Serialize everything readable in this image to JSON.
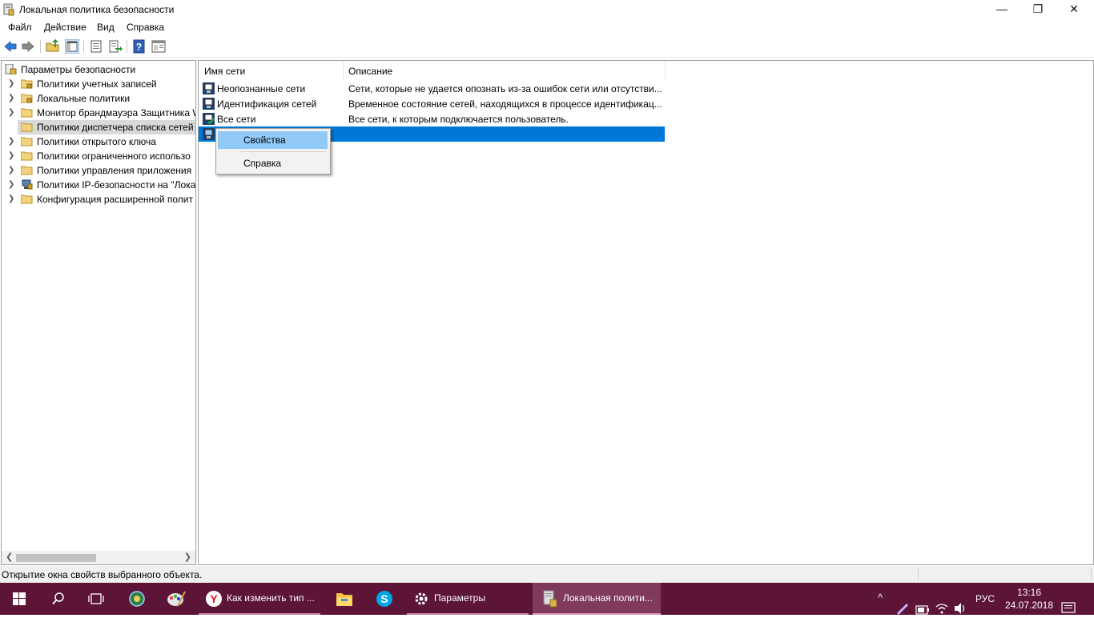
{
  "window": {
    "title": "Локальная политика безопасности",
    "controls": {
      "minimize": "—",
      "maximize": "❐",
      "close": "✕"
    }
  },
  "menu": [
    "Файл",
    "Действие",
    "Вид",
    "Справка"
  ],
  "toolbar": {
    "icons": [
      "back-icon",
      "forward-icon",
      "up-folder-icon",
      "show-hide-tree-icon",
      "properties-icon",
      "export-list-icon",
      "help-icon",
      "console-icon"
    ]
  },
  "tree": {
    "root": "Параметры безопасности",
    "items": [
      {
        "label": "Политики учетных записей",
        "icon": "folder-lock-icon",
        "selected": false
      },
      {
        "label": "Локальные политики",
        "icon": "folder-lock-icon",
        "selected": false
      },
      {
        "label": "Монитор брандмауэра Защитника W",
        "icon": "folder-icon",
        "selected": false
      },
      {
        "label": "Политики диспетчера списка сетей",
        "icon": "folder-icon",
        "selected": true
      },
      {
        "label": "Политики открытого ключа",
        "icon": "folder-icon",
        "selected": false
      },
      {
        "label": "Политики ограниченного использо",
        "icon": "folder-icon",
        "selected": false
      },
      {
        "label": "Политики управления приложения",
        "icon": "folder-icon",
        "selected": false
      },
      {
        "label": "Политики IP-безопасности на \"Лока",
        "icon": "ip-security-icon",
        "selected": false
      },
      {
        "label": "Конфигурация расширенной полит",
        "icon": "folder-icon",
        "selected": false
      }
    ],
    "scroll_left": "❮",
    "scroll_right": "❯"
  },
  "list": {
    "columns": [
      "Имя сети",
      "Описание"
    ],
    "rows": [
      {
        "name": "Неопознанные сети",
        "description": "Сети, которые не удается опознать из-за ошибок сети или отсутстви...",
        "icon": "unidentified-network-icon"
      },
      {
        "name": "Идентификация сетей",
        "description": "Временное состояние сетей, находящихся в процессе идентификац...",
        "icon": "identifying-network-icon"
      },
      {
        "name": "Все сети",
        "description": "Все сети, к которым подключается пользователь.",
        "icon": "all-networks-icon"
      },
      {
        "name": "",
        "description": "",
        "icon": "network-icon",
        "selected": true
      }
    ]
  },
  "context_menu": {
    "items": [
      "Свойства",
      "Справка"
    ],
    "highlighted": "Свойства"
  },
  "status": {
    "text": "Открытие окна свойств выбранного объекта."
  },
  "taskbar": {
    "items": [
      {
        "label": "",
        "icon": "windows-start-icon"
      },
      {
        "label": "",
        "icon": "search-icon"
      },
      {
        "label": "",
        "icon": "task-view-icon"
      },
      {
        "label": "",
        "icon": "app-globe-icon"
      },
      {
        "label": "",
        "icon": "paint-palette-icon"
      },
      {
        "label": "Как изменить тип ...",
        "icon": "yandex-browser-icon"
      },
      {
        "label": "",
        "icon": "file-explorer-icon"
      },
      {
        "label": "",
        "icon": "skype-icon"
      },
      {
        "label": "Параметры",
        "icon": "settings-gear-icon"
      },
      {
        "label": "Локальная полити...",
        "icon": "security-policy-icon"
      }
    ],
    "tray": {
      "chevron": "^",
      "language": "РУС",
      "time": "13:16",
      "date": "24.07.2018"
    }
  },
  "colors": {
    "selection": "#0078d7",
    "menu_highlight": "#91c9f7",
    "taskbar": "#5c1437"
  }
}
